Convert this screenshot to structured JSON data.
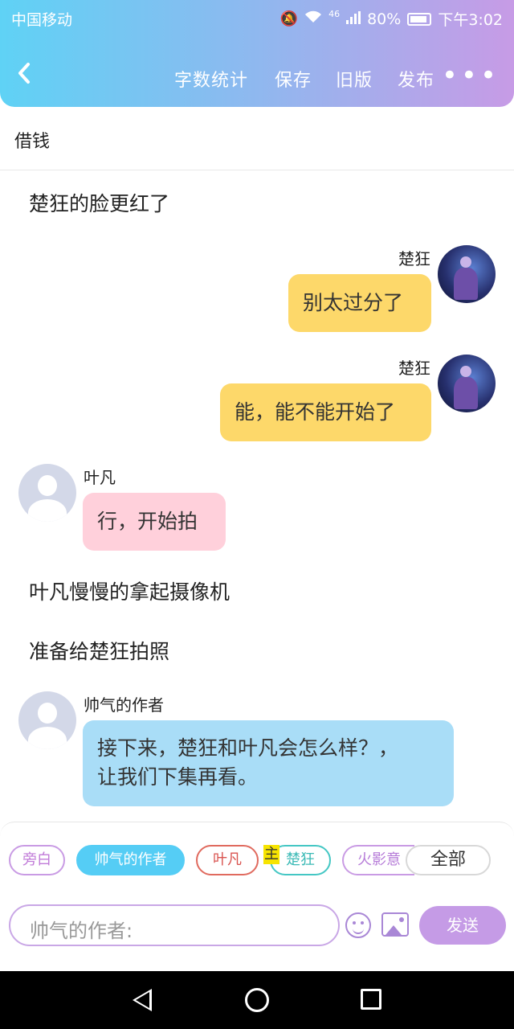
{
  "status_bar": {
    "carrier": "中国移动",
    "signal": "46",
    "battery": "80%",
    "time": "下午3:02"
  },
  "toolbar": {
    "word_count": "字数统计",
    "save": "保存",
    "old_version": "旧版",
    "publish": "发布",
    "more": "•••"
  },
  "document": {
    "title": "借钱"
  },
  "story": [
    {
      "type": "narration",
      "text": "楚狂的脸更红了"
    },
    {
      "type": "message",
      "side": "right",
      "speaker": "楚狂",
      "text": "别太过分了"
    },
    {
      "type": "message",
      "side": "right",
      "speaker": "楚狂",
      "text": "能，能不能开始了"
    },
    {
      "type": "message",
      "side": "left",
      "speaker": "叶凡",
      "text": "行，开始拍"
    },
    {
      "type": "narration",
      "text": "叶凡慢慢的拿起摄像机"
    },
    {
      "type": "narration",
      "text": "准备给楚狂拍照"
    },
    {
      "type": "message",
      "side": "left",
      "speaker": "帅气的作者",
      "text_line1": "接下来，楚狂和叶凡会怎么样？，",
      "text_line2": "让我们下集再看。"
    }
  ],
  "roles": {
    "narrator": "旁白",
    "author": "帅气的作者",
    "ye_fan": "叶凡",
    "chu_kuang": "楚狂",
    "fire": "火影意",
    "main_mark": "主",
    "all": "全部"
  },
  "composer": {
    "placeholder": "帅气的作者:",
    "send": "发送"
  },
  "colors": {
    "header_start": "#5fd2f5",
    "header_end": "#c79be6",
    "yellow_bubble": "#fdd86a",
    "pink_bubble": "#ffd0db",
    "blue_bubble": "#a9ddf7",
    "send_button": "#c59be6"
  }
}
